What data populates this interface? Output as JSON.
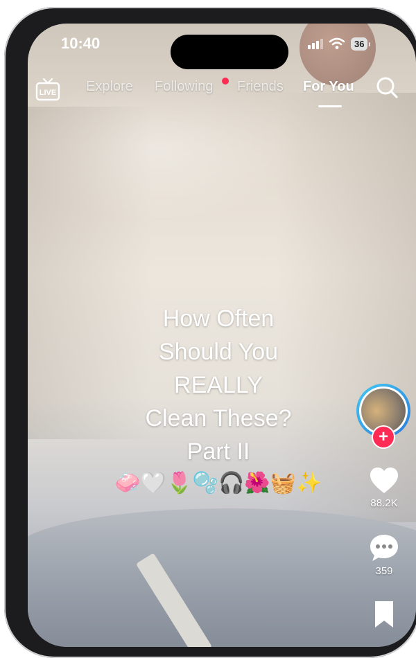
{
  "status_bar": {
    "time": "10:40",
    "battery": "36"
  },
  "top_nav": {
    "live_label": "LIVE",
    "tabs": [
      {
        "label": "Explore",
        "active": false
      },
      {
        "label": "Following",
        "active": false,
        "has_notification": true
      },
      {
        "label": "Friends",
        "active": false
      },
      {
        "label": "For You",
        "active": true
      }
    ]
  },
  "video": {
    "caption_lines": [
      "How Often",
      "Should You",
      "REALLY",
      "Clean These?",
      "Part II"
    ],
    "emoji_row": "🧼🤍🌷🫧🎧🌺🧺✨"
  },
  "actions": {
    "follow_symbol": "+",
    "like_count": "88.2K",
    "comment_count": "359"
  },
  "colors": {
    "accent": "#fe2c55",
    "avatar_ring": "#2ba7e8",
    "text": "#ffffff"
  }
}
